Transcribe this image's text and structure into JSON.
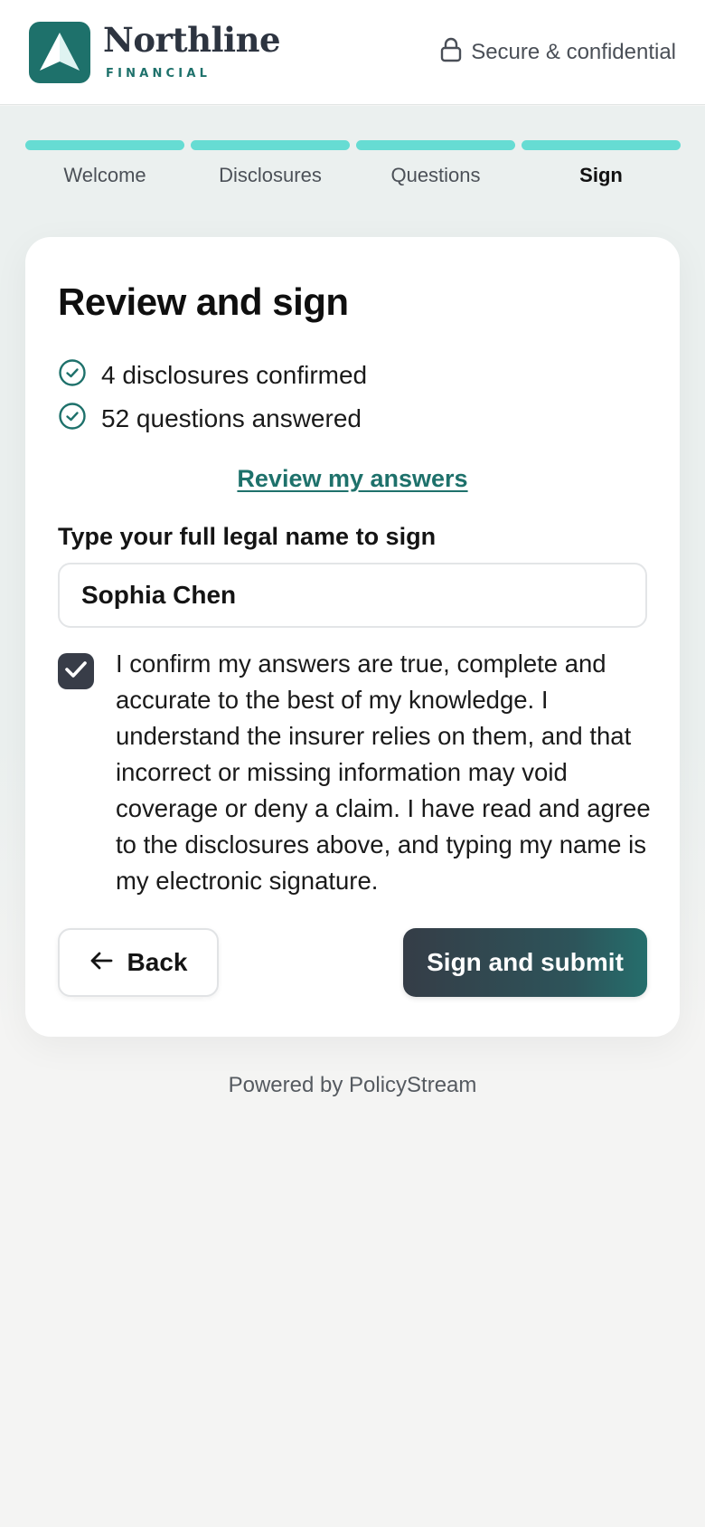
{
  "header": {
    "brand_name": "Northline",
    "brand_sub": "FINANCIAL",
    "secure_label": "Secure & confidential"
  },
  "steps": [
    {
      "label": "Welcome",
      "active": false
    },
    {
      "label": "Disclosures",
      "active": false
    },
    {
      "label": "Questions",
      "active": false
    },
    {
      "label": "Sign",
      "active": true
    }
  ],
  "card": {
    "title": "Review and sign",
    "summary": [
      "4 disclosures confirmed",
      "52 questions answered"
    ],
    "review_link": "Review my answers",
    "name_label": "Type your full legal name to sign",
    "name_value": "Sophia Chen",
    "confirm_checked": true,
    "confirm_text": "I confirm my answers are true, complete and accurate to the best of my knowledge. I understand the insurer relies on them, and that incorrect or missing information may void coverage or deny a claim. I have read and agree to the disclosures above, and typing my name is my electronic signature.",
    "back_label": "Back",
    "submit_label": "Sign and submit"
  },
  "footer": {
    "text": "Powered by PolicyStream"
  },
  "colors": {
    "brand": "#1e716b",
    "progress": "#66dcd3",
    "dark": "#383d48"
  }
}
